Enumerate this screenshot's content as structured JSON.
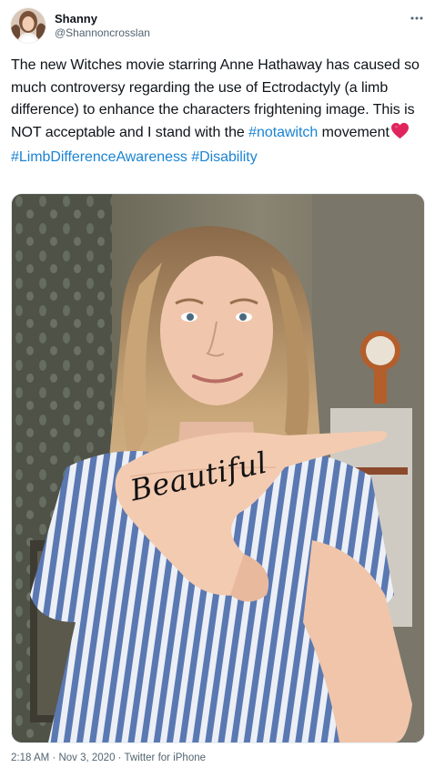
{
  "author": {
    "display_name": "Shanny",
    "handle": "@Shannoncrosslan",
    "avatar_icon": "profile-photo-avatar"
  },
  "menu_icon": "more-dots-icon",
  "tweet": {
    "text_1": "The new Witches movie starring Anne Hathaway has caused so much controversy regarding the use of Ectrodactyly (a limb difference) to enhance the characters frightening image. This is NOT acceptable and I stand with the ",
    "hashtag_1": "#notawitch",
    "text_2": " movement",
    "emoji": "red-heart-icon",
    "hashtag_2": "#LimbDifferenceAwareness",
    "hashtag_3": "#Disability"
  },
  "media": {
    "handwriting": "Beautiful"
  },
  "footer": {
    "time": "2:18 AM",
    "separator": "·",
    "date": "Nov 3, 2020",
    "source": "Twitter for iPhone"
  },
  "colors": {
    "link": "#1b84d3",
    "text": "#0f1419",
    "secondary": "#536471",
    "heart": "#e0245e"
  }
}
